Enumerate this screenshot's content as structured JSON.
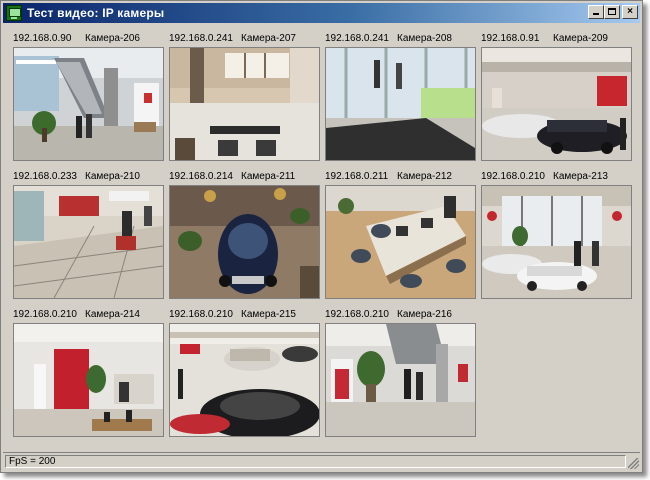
{
  "window": {
    "title": "Тест видео: IP камеры",
    "minimize_label": "",
    "maximize_label": "",
    "close_label": "×"
  },
  "cameras": [
    {
      "ip": "192.168.0.90",
      "name": "Камера-206",
      "scene": "lobby-staircase"
    },
    {
      "ip": "192.168.0.241",
      "name": "Камера-207",
      "scene": "hall-doors"
    },
    {
      "ip": "192.168.0.241",
      "name": "Камера-208",
      "scene": "glass-entrance"
    },
    {
      "ip": "192.168.0.91",
      "name": "Камера-209",
      "scene": "showroom-cars"
    },
    {
      "ip": "192.168.0.233",
      "name": "Камера-210",
      "scene": "cleaning-floor"
    },
    {
      "ip": "192.168.0.214",
      "name": "Камера-211",
      "scene": "car-topdown"
    },
    {
      "ip": "192.168.0.211",
      "name": "Камера-212",
      "scene": "office-desks"
    },
    {
      "ip": "192.168.0.210",
      "name": "Камера-213",
      "scene": "showroom-white-car"
    },
    {
      "ip": "192.168.0.210",
      "name": "Камера-214",
      "scene": "reception-red"
    },
    {
      "ip": "192.168.0.210",
      "name": "Камера-215",
      "scene": "showroom-floor-cars"
    },
    {
      "ip": "192.168.0.210",
      "name": "Камера-216",
      "scene": "lobby-people"
    }
  ],
  "status": {
    "fps_text": "FpS = 200"
  }
}
